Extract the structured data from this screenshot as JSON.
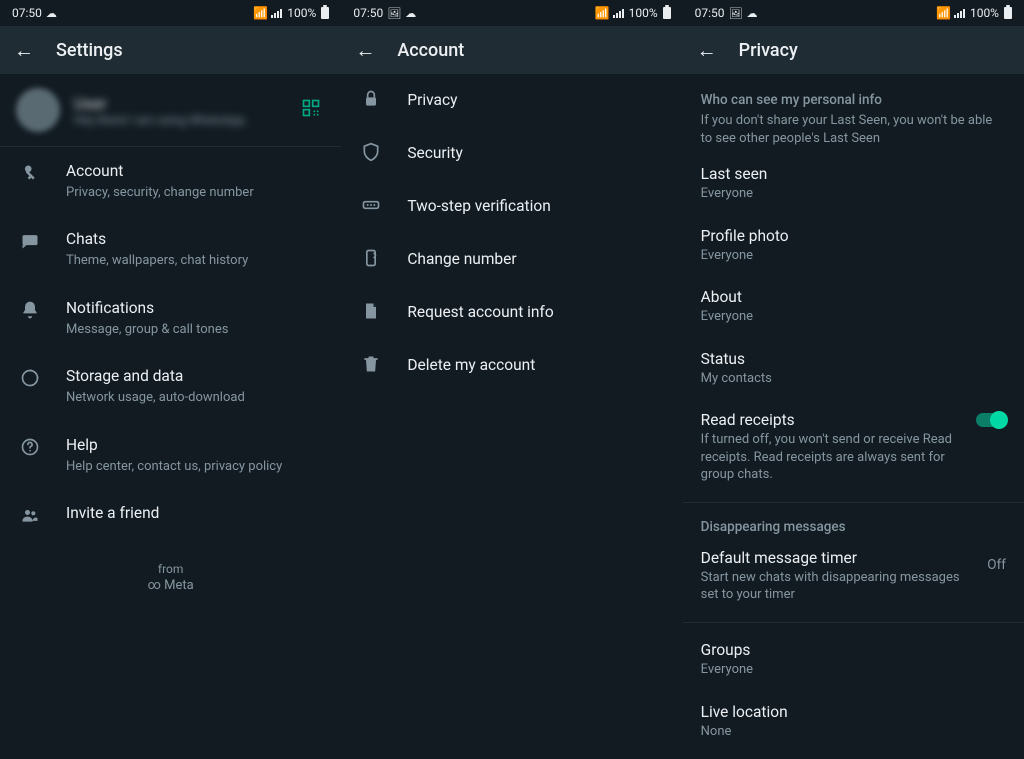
{
  "status": {
    "time": "07:50",
    "pct": "100%"
  },
  "pane1": {
    "title": "Settings",
    "profile_name": "User",
    "profile_sub": "Hey there! I am using WhatsApp.",
    "items": [
      {
        "icon": "key",
        "title": "Account",
        "sub": "Privacy, security, change number"
      },
      {
        "icon": "chat",
        "title": "Chats",
        "sub": "Theme, wallpapers, chat history"
      },
      {
        "icon": "bell",
        "title": "Notifications",
        "sub": "Message, group & call tones"
      },
      {
        "icon": "data",
        "title": "Storage and data",
        "sub": "Network usage, auto-download"
      },
      {
        "icon": "help",
        "title": "Help",
        "sub": "Help center, contact us, privacy policy"
      },
      {
        "icon": "group",
        "title": "Invite a friend",
        "sub": ""
      }
    ],
    "footer_from": "from",
    "footer_meta": "Meta"
  },
  "pane2": {
    "title": "Account",
    "items": [
      {
        "icon": "lock",
        "label": "Privacy"
      },
      {
        "icon": "shield",
        "label": "Security"
      },
      {
        "icon": "pin",
        "label": "Two-step verification"
      },
      {
        "icon": "phone",
        "label": "Change number"
      },
      {
        "icon": "doc",
        "label": "Request account info"
      },
      {
        "icon": "trash",
        "label": "Delete my account"
      }
    ]
  },
  "pane3": {
    "title": "Privacy",
    "section1_title": "Who can see my personal info",
    "section1_desc": "If you don't share your Last Seen, you won't be able to see other people's Last Seen",
    "last_seen": {
      "title": "Last seen",
      "value": "Everyone"
    },
    "profile_photo": {
      "title": "Profile photo",
      "value": "Everyone"
    },
    "about": {
      "title": "About",
      "value": "Everyone"
    },
    "status": {
      "title": "Status",
      "value": "My contacts"
    },
    "read_receipts": {
      "title": "Read receipts",
      "desc": "If turned off, you won't send or receive Read receipts. Read receipts are always sent for group chats."
    },
    "section2_title": "Disappearing messages",
    "default_timer": {
      "title": "Default message timer",
      "desc": "Start new chats with disappearing messages set to your timer",
      "value": "Off"
    },
    "groups": {
      "title": "Groups",
      "value": "Everyone"
    },
    "live_location": {
      "title": "Live location",
      "value": "None"
    }
  }
}
